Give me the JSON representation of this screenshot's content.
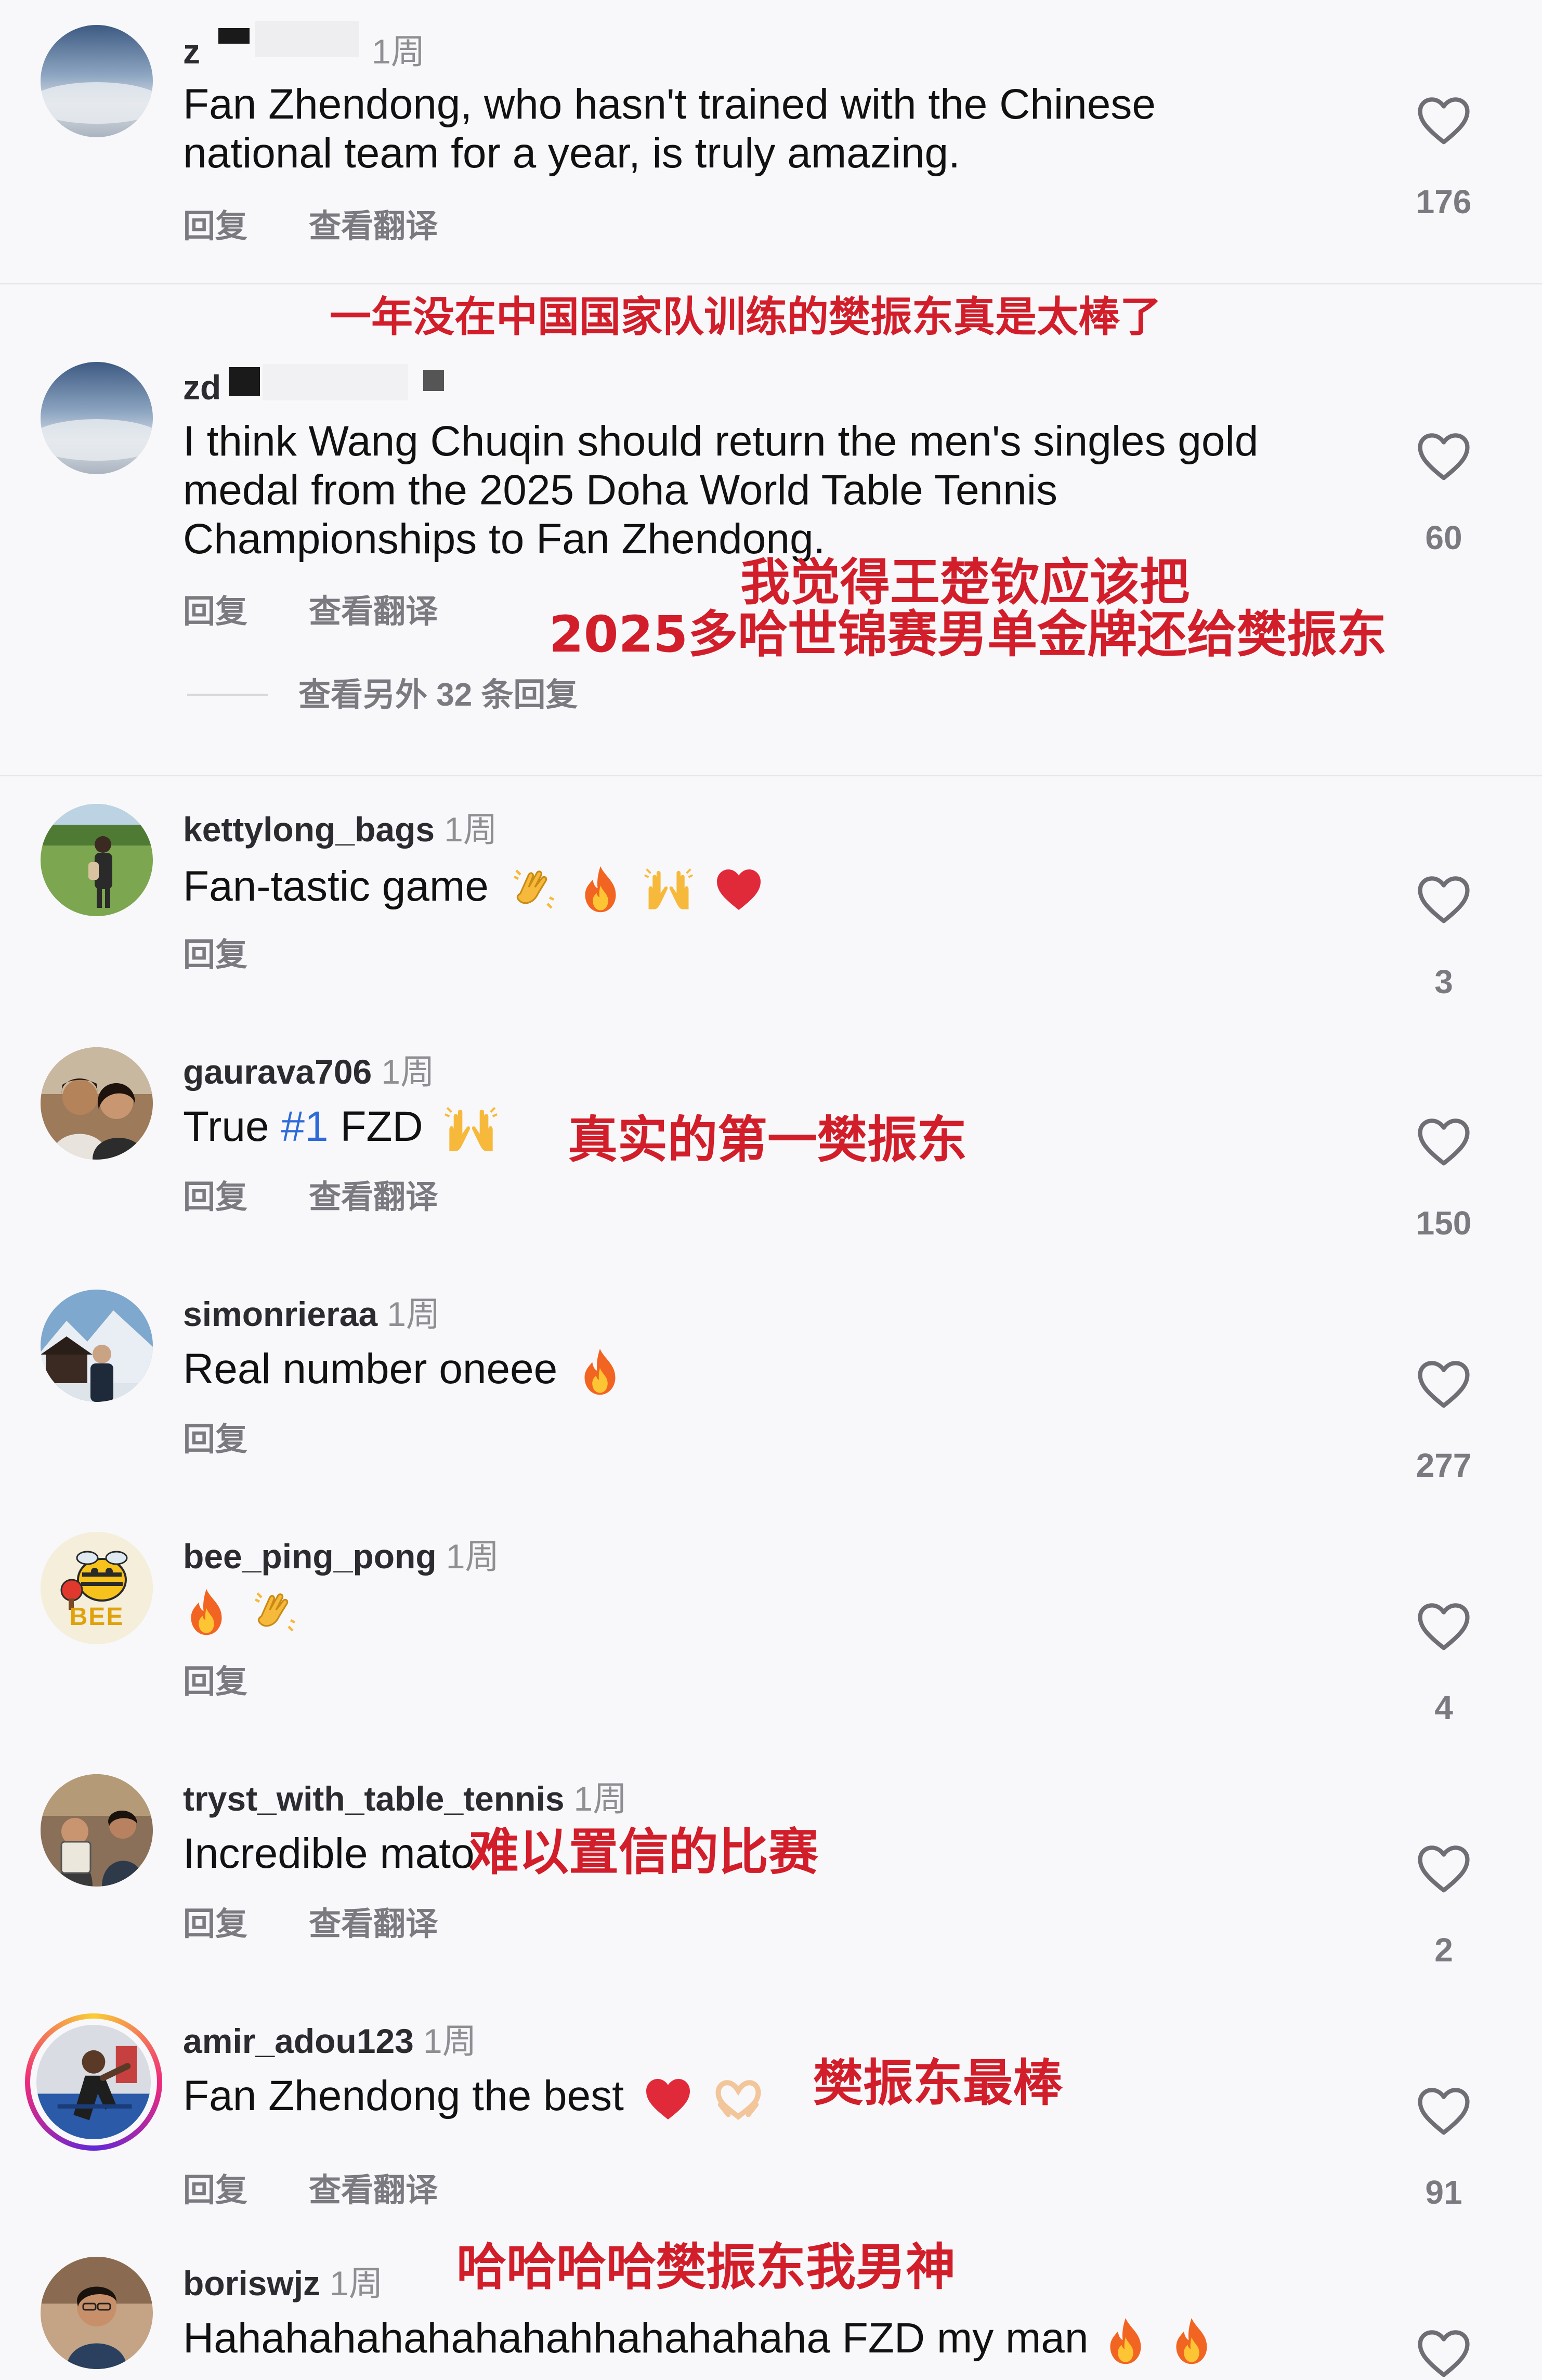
{
  "comments": [
    {
      "username": "z",
      "time": "1周",
      "text_lines": [
        "Fan Zhendong, who hasn't trained with the Chinese",
        "national team for a year, is truly amazing."
      ],
      "reply_label": "回复",
      "translate_label": "查看翻译",
      "like_count": "176",
      "caption": "一年没在中国国家队训练的樊振东真是太棒了"
    },
    {
      "username": "zd",
      "time": "",
      "text_lines": [
        "I think Wang Chuqin should return the men's singles gold",
        "medal from the 2025 Doha World Table Tennis",
        "Championships to Fan Zhendong."
      ],
      "reply_label": "回复",
      "translate_label": "查看翻译",
      "like_count": "60",
      "caption_lines": [
        "我觉得王楚钦应该把",
        "2025多哈世锦赛男单金牌还给樊振东"
      ],
      "more_replies": "查看另外 32 条回复"
    },
    {
      "username": "kettylong_bags",
      "time": "1周",
      "text": "Fan-tastic game",
      "emojis": [
        "clap",
        "fire",
        "raised-hands",
        "heart"
      ],
      "reply_label": "回复",
      "like_count": "3"
    },
    {
      "username": "gaurava706",
      "time": "1周",
      "text_before": "True ",
      "hashtag": "#1",
      "text_after": " FZD",
      "emojis": [
        "raised-hands"
      ],
      "reply_label": "回复",
      "translate_label": "查看翻译",
      "like_count": "150",
      "caption": "真实的第一樊振东"
    },
    {
      "username": "simonrieraa",
      "time": "1周",
      "text": "Real number oneee",
      "emojis": [
        "fire"
      ],
      "reply_label": "回复",
      "like_count": "277"
    },
    {
      "username": "bee_ping_pong",
      "time": "1周",
      "text": "",
      "emojis": [
        "fire",
        "clap"
      ],
      "reply_label": "回复",
      "like_count": "4",
      "avatar_text": "BEE"
    },
    {
      "username": "tryst_with_table_tennis",
      "time": "1周",
      "text": "Incredible mato",
      "reply_label": "回复",
      "translate_label": "查看翻译",
      "like_count": "2",
      "caption": "难以置信的比赛"
    },
    {
      "username": "amir_adou123",
      "time": "1周",
      "text": "Fan Zhendong the best",
      "emojis": [
        "heart",
        "heart-hands"
      ],
      "reply_label": "回复",
      "translate_label": "查看翻译",
      "like_count": "91",
      "caption": "樊振东最棒"
    },
    {
      "username": "boriswjz",
      "time": "1周",
      "text": "Hahahahahahahahahhahahahaha FZD my man",
      "emojis": [
        "fire",
        "fire"
      ],
      "caption": "哈哈哈哈樊振东我男神"
    }
  ],
  "colors": {
    "background": "#f8f8fa",
    "caption_red": "#d11e2a",
    "hashtag_blue": "#2f6bd8",
    "muted_gray": "#7a7a80",
    "story_ring_start": "#f9ce34",
    "story_ring_mid": "#ee2a7b",
    "story_ring_end": "#6228d7"
  },
  "icons": {
    "like": "heart-outline-icon"
  }
}
